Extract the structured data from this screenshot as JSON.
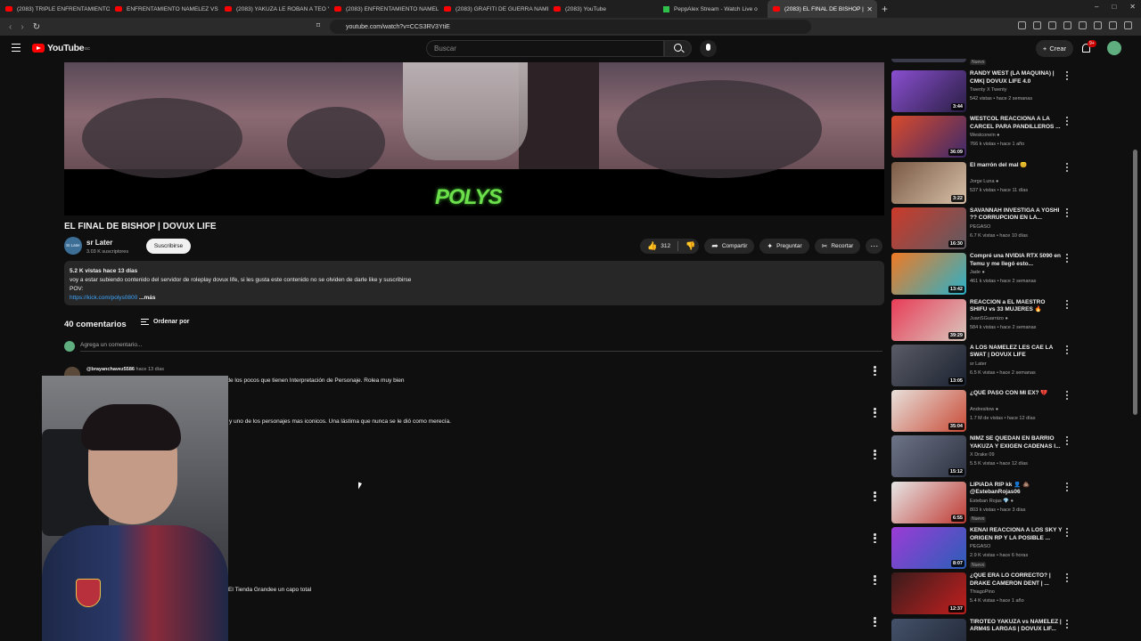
{
  "browser": {
    "tabs": [
      {
        "title": "(2083) TRIPLE ENFRENTAMIENTO NA",
        "kind": "yt"
      },
      {
        "title": "ENFRENTAMIENTO NAMELEZ VS YO",
        "kind": "yt"
      },
      {
        "title": "(2083) YAKUZA LE ROBAN A TEO Y S",
        "kind": "yt"
      },
      {
        "title": "(2083) ENFRENTAMIENTO NAMELE",
        "kind": "yt"
      },
      {
        "title": "(2083) GRAFITI DE GUERRA NAMELE",
        "kind": "yt"
      },
      {
        "title": "(2083) YouTube",
        "kind": "yt"
      },
      {
        "title": "PeppAlex Stream - Watch Live o",
        "kind": "pp"
      },
      {
        "title": "(2083) EL FINAL DE BISHOP |",
        "kind": "yt",
        "active": true
      }
    ],
    "url": "youtube.com/watch?v=CCS3RV3YtiE",
    "new_tab": "+",
    "window_controls": [
      "–",
      "□",
      "✕"
    ]
  },
  "header": {
    "logo_text": "YouTube",
    "logo_region": "EC",
    "search_placeholder": "Buscar",
    "create_label": "Crear",
    "notif_count": "9+"
  },
  "video": {
    "watermark": "POLYS",
    "title": "EL FINAL DE BISHOP | DOVUX LIFE",
    "channel": {
      "name": "sr Later",
      "subs": "3.03 K suscriptores",
      "avatar_text": "Sr.Later"
    },
    "subscribe_label": "Suscribirse",
    "likes": "312",
    "share_label": "Compartir",
    "ask_label": "Preguntar",
    "clip_label": "Recortar",
    "description": {
      "meta": "5.2 K vistas  hace 13 días",
      "line1": "voy a estar subiendo contenido del servidor de roleplay dovux life, si les gusta este contenido no se olviden de darle like y suscribirse",
      "line2": "POV:",
      "link": "https://kick.com/polys0800",
      "more": " ...más"
    }
  },
  "comments": {
    "count_label": "40 comentarios",
    "sort_label": "Ordenar por",
    "add_placeholder": "Agrega un comentario...",
    "first_author": "@brayanchavez5586",
    "first_time": "hace 13 días",
    "visible_texts": [
      "mi es de los pocos que tienen Interpretación de Personaje. Rolea muy bien",
      "y uno de los personajes mas iconicos. Una lástima que nunca se le dió como merecía.",
      "El Tienda Grandee un capo total"
    ]
  },
  "sidebar": {
    "partial_top_badge": "Nuevo",
    "items": [
      {
        "title": "RANDY WEST (LA MAQUINA) | CMK| DOVUX LIFE 4.0",
        "channel": "Twenty X Twenty",
        "views": "542 vistas • hace 2 semanas",
        "duration": "3:44",
        "colors": [
          "#8a4fd1",
          "#2a1f44"
        ]
      },
      {
        "title": "WESTCOL REACCIONA A LA CARCEL PARA PANDILLEROS ...",
        "channel": "Westconein ●",
        "views": "766 k vistas • hace 1 año",
        "duration": "36:09",
        "colors": [
          "#d94a2b",
          "#3d2a6b"
        ]
      },
      {
        "title": "El marrón del mal 😊",
        "channel": "Jorge Luna ●",
        "views": "537 k vistas • hace 11 días",
        "duration": "3:22",
        "colors": [
          "#7a5a44",
          "#d8c0a8"
        ]
      },
      {
        "title": "SAVANNAH INVESTIGA A YOSHI ?? CORRUPCION EN LA...",
        "channel": "PEGASO",
        "views": "6.7 K vistas • hace 10 días",
        "duration": "16:30",
        "colors": [
          "#cc3a2a",
          "#5e5b63"
        ]
      },
      {
        "title": "Compré una NVIDIA RTX 5090 en Temu y me llegó esto...",
        "channel": "Jade ●",
        "views": "461 k vistas • hace 2 semanas",
        "duration": "13:42",
        "colors": [
          "#f07a24",
          "#2ab1c9"
        ]
      },
      {
        "title": "REACCIÓN a EL MAESTRO SHIFU vs 33 MUJERES 🔥",
        "channel": "JuanSGuarnizo ●",
        "views": "584 k vistas • hace 2 semanas",
        "duration": "39:29",
        "colors": [
          "#e83c57",
          "#d9c7bd"
        ]
      },
      {
        "title": "A LOS NAMELEZ LES CAE LA SWAT | DOVUX LIFE",
        "channel": "sr Later",
        "views": "6.5 K vistas • hace 2 semanas",
        "duration": "13:05",
        "colors": [
          "#5a5c66",
          "#1b2230"
        ]
      },
      {
        "title": "¿QUÉ PASÓ CON MI EX? 💔",
        "channel": "Andresitow ●",
        "views": "1.7 M de vistas • hace 12 días",
        "duration": "35:04",
        "colors": [
          "#e7e0da",
          "#c94c38"
        ]
      },
      {
        "title": "NIMZ SE QUEDAN EN BARRIO YAKUZA Y EXIGEN CADENAS I...",
        "channel": "X Drake 09",
        "views": "5.5 K vistas • hace 12 días",
        "duration": "15:12",
        "colors": [
          "#6d7487",
          "#2d3241"
        ]
      },
      {
        "title": "LIPIADA RIP kk 👤 💩 @EstebanRojas06",
        "channel": "Esteban Rojas 💎 ●",
        "views": "803 k vistas • hace 3 días",
        "duration": "6:55",
        "colors": [
          "#e6e6e6",
          "#c03a33"
        ],
        "new": "Nuevo"
      },
      {
        "title": "KENAI REACCIONA A LOS SKY Y ORIGEN RP Y LA POSIBLE ...",
        "channel": "PEGASO",
        "views": "2.9 K vistas • hace 6 horas",
        "duration": "8:07",
        "colors": [
          "#9c3bd6",
          "#2a5fb8"
        ],
        "new": "Nuevo"
      },
      {
        "title": "¿QUE ERA LO CORRECTO? | DRAKE CAMERON DENT | ...",
        "channel": "ThiagoPino",
        "views": "5.4 K vistas • hace 1 año",
        "duration": "12:37",
        "colors": [
          "#3a1c1c",
          "#c21f1f"
        ]
      },
      {
        "title": "TIROTEO YAKUZA vs NAMELEZ | ARM4S LARGAS | DOVUX LIF...",
        "channel": "",
        "views": "",
        "duration": "",
        "colors": [
          "#44526a",
          "#1f2533"
        ]
      }
    ]
  }
}
